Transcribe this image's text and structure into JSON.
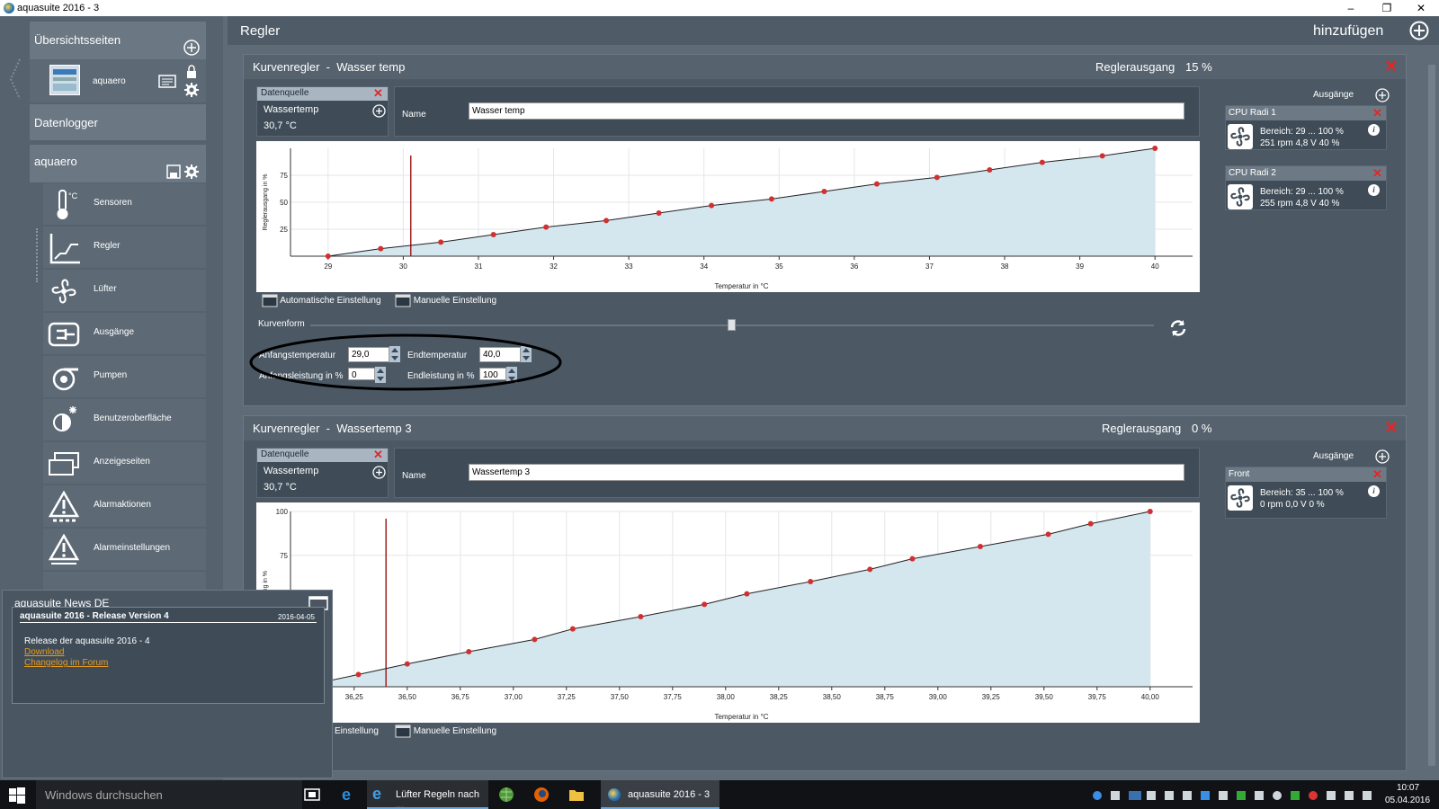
{
  "window": {
    "title": "aquasuite 2016 - 3",
    "minimize": "–",
    "restore": "❐",
    "close": "✕"
  },
  "sidebar": {
    "overview_title": "Übersichtsseiten",
    "overview_item": "aquaero",
    "datalogger": "Datenlogger",
    "device": "aquaero",
    "items": [
      {
        "label": "Sensoren",
        "icon": "thermometer-icon"
      },
      {
        "label": "Regler",
        "icon": "controller-icon"
      },
      {
        "label": "Lüfter",
        "icon": "fan-icon"
      },
      {
        "label": "Ausgänge",
        "icon": "outputs-icon"
      },
      {
        "label": "Pumpen",
        "icon": "pump-icon"
      },
      {
        "label": "Benutzeroberfläche",
        "icon": "brightness-icon"
      },
      {
        "label": "Anzeigeseiten",
        "icon": "display-pages-icon"
      },
      {
        "label": "Alarmaktionen",
        "icon": "alarm-actions-icon"
      },
      {
        "label": "Alarmeinstellungen",
        "icon": "alarm-settings-icon"
      }
    ]
  },
  "main": {
    "title": "Regler",
    "add_label": "hinzufügen"
  },
  "panel1": {
    "type": "Kurvenregler",
    "sep": "-",
    "name": "Wasser temp",
    "output_label": "Reglerausgang",
    "output_value": "15 %",
    "source_label": "Datenquelle",
    "source_name": "Wassertemp",
    "source_value": "30,7 °C",
    "name_label": "Name",
    "name_value": "Wasser temp",
    "outputs_label": "Ausgänge",
    "outputs": [
      {
        "name": "CPU Radi 1",
        "range": "Bereich:  29 ... 100  %",
        "status": "251 rpm  4,8 V  40 %"
      },
      {
        "name": "CPU Radi 2",
        "range": "Bereich:  29 ... 100  %",
        "status": "255 rpm  4,8 V  40 %"
      }
    ],
    "auto_label": "Automatische Einstellung",
    "manual_label": "Manuelle Einstellung",
    "curve_label": "Kurvenform",
    "start_temp_label": "Anfangstemperatur",
    "start_temp": "29,0",
    "end_temp_label": "Endtemperatur",
    "end_temp": "40,0",
    "start_power_label": "Anfangsleistung in %",
    "start_power": "0",
    "end_power_label": "Endleistung in %",
    "end_power": "100"
  },
  "panel2": {
    "type": "Kurvenregler",
    "sep": "-",
    "name": "Wassertemp 3",
    "output_label": "Reglerausgang",
    "output_value": "0 %",
    "source_label": "Datenquelle",
    "source_name": "Wassertemp",
    "source_value": "30,7 °C",
    "name_label": "Name",
    "name_value": "Wassertemp 3",
    "outputs_label": "Ausgänge",
    "outputs": [
      {
        "name": "Front",
        "range": "Bereich:  35 ... 100  %",
        "status": "0 rpm  0,0 V  0 %"
      }
    ],
    "auto_label_partial": "Einstellung",
    "manual_label": "Manuelle Einstellung"
  },
  "chart_data": [
    {
      "type": "line",
      "xlabel": "Temperatur in °C",
      "ylabel": "Reglerausgang in %",
      "xlim": [
        28.5,
        40.5
      ],
      "ylim": [
        0,
        100
      ],
      "x_ticks": [
        "29",
        "30",
        "31",
        "32",
        "33",
        "34",
        "35",
        "36",
        "37",
        "38",
        "39",
        "40"
      ],
      "y_ticks": [
        "25",
        "50",
        "75"
      ],
      "x": [
        29.0,
        29.7,
        30.5,
        31.2,
        31.9,
        32.7,
        33.4,
        34.1,
        34.9,
        35.6,
        36.3,
        37.1,
        37.8,
        38.5,
        39.3,
        40.0
      ],
      "y": [
        0,
        7,
        13,
        20,
        27,
        33,
        40,
        47,
        53,
        60,
        67,
        73,
        80,
        87,
        93,
        100
      ],
      "marker_x": 30.1,
      "area_fill": true,
      "grid": true
    },
    {
      "type": "line",
      "xlabel": "Temperatur in °C",
      "ylabel": "Reglerausgang in %",
      "xlim": [
        35.95,
        40.2
      ],
      "ylim": [
        0,
        100
      ],
      "x_ticks": [
        "36,25",
        "36,50",
        "36,75",
        "37,00",
        "37,25",
        "37,50",
        "37,75",
        "38,00",
        "38,25",
        "38,50",
        "38,75",
        "39,00",
        "39,25",
        "39,50",
        "39,75",
        "40,00"
      ],
      "y_ticks": [
        "75",
        "100"
      ],
      "x": [
        36.0,
        36.27,
        36.5,
        36.79,
        37.1,
        37.28,
        37.6,
        37.9,
        38.1,
        38.4,
        38.68,
        38.88,
        39.2,
        39.52,
        39.72,
        40.0
      ],
      "y": [
        0,
        7,
        13,
        20,
        27,
        33,
        40,
        47,
        53,
        60,
        67,
        73,
        80,
        87,
        93,
        100
      ],
      "marker_x": 36.4,
      "area_fill": true,
      "grid": true
    }
  ],
  "news": {
    "title": "aquasuite News DE",
    "item_title": "aquasuite 2016 - Release Version 4",
    "item_date": "2016-04-05",
    "item_text": "Release der aquasuite 2016 - 4",
    "link1": "Download",
    "link2": "Changelog im Forum"
  },
  "taskbar": {
    "search_placeholder": "Windows durchsuchen",
    "app1": "Lüfter Regeln nach ...",
    "app2": "aquasuite 2016 - 3",
    "time": "10:07",
    "date": "05.04.2016"
  }
}
